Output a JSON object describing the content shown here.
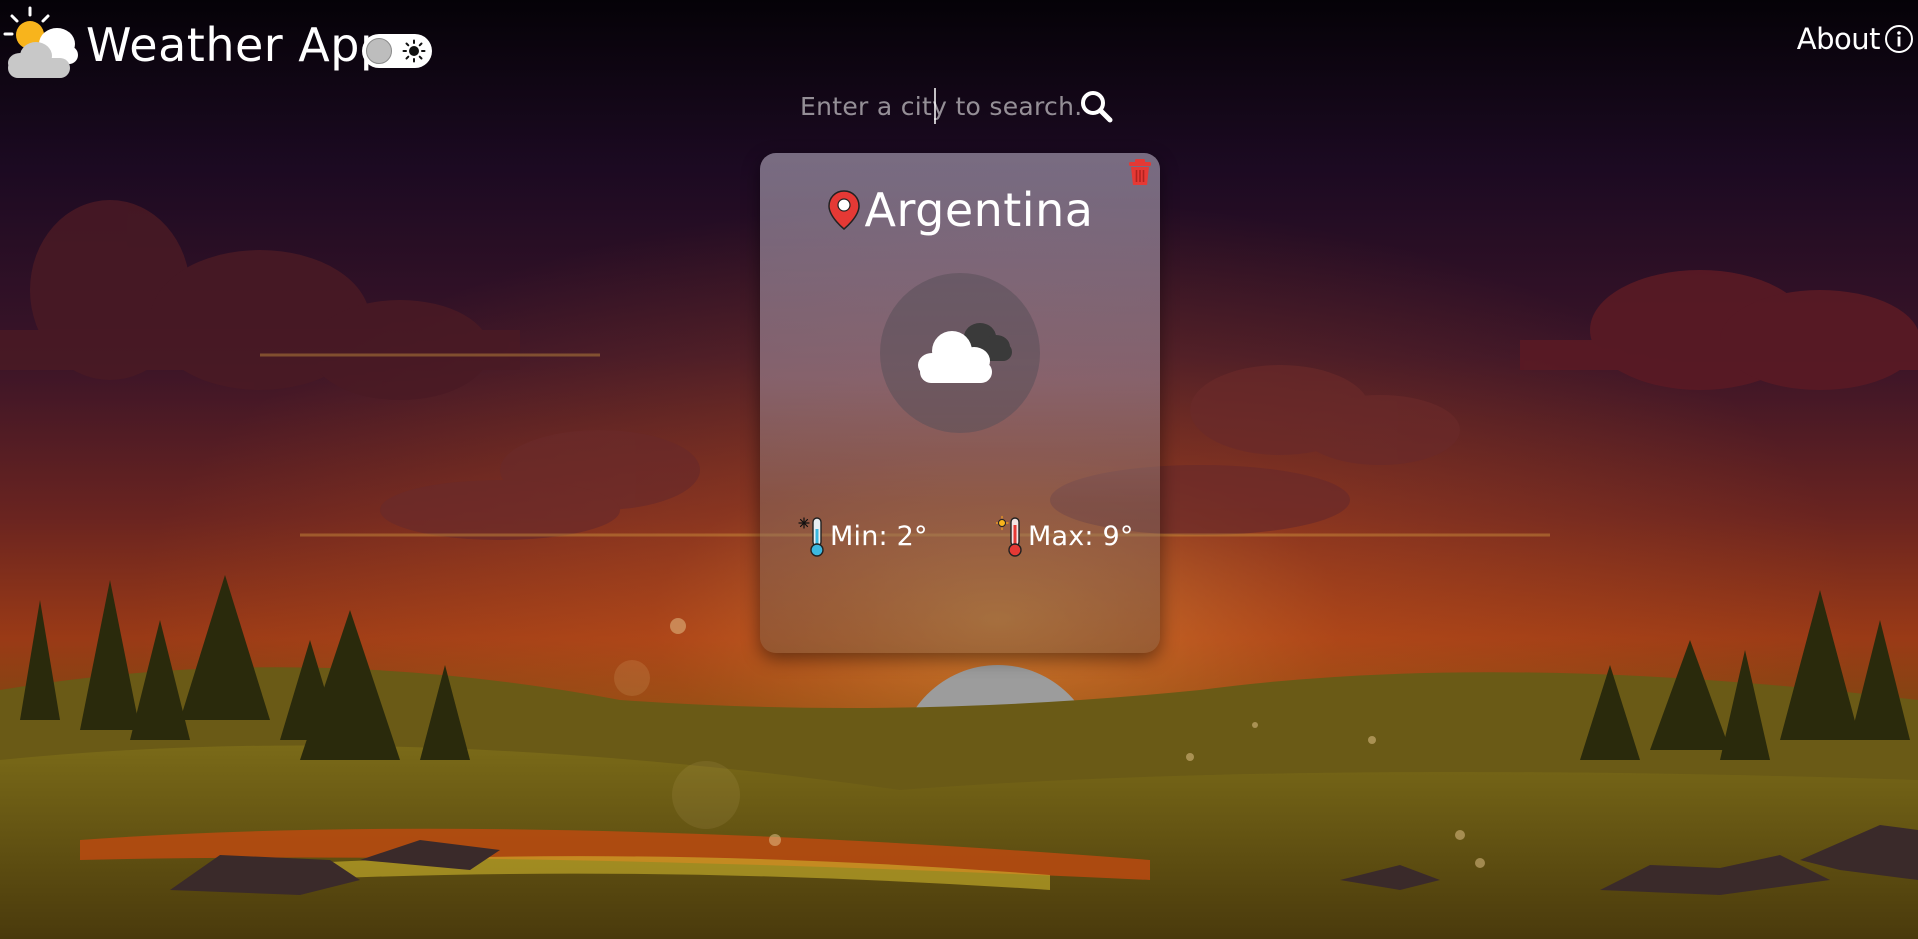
{
  "app": {
    "title": "Weather App"
  },
  "header": {
    "about_label": "About",
    "theme_toggle_state": "light"
  },
  "search": {
    "placeholder": "Enter a city to search...",
    "value": ""
  },
  "card": {
    "city": "Argentina",
    "condition_icon": "cloudy-icon",
    "min_label": "Min: 2°",
    "max_label": "Max: 9°"
  },
  "colors": {
    "pin": "#e53935",
    "delete": "#e53935",
    "text": "#ffffff"
  }
}
